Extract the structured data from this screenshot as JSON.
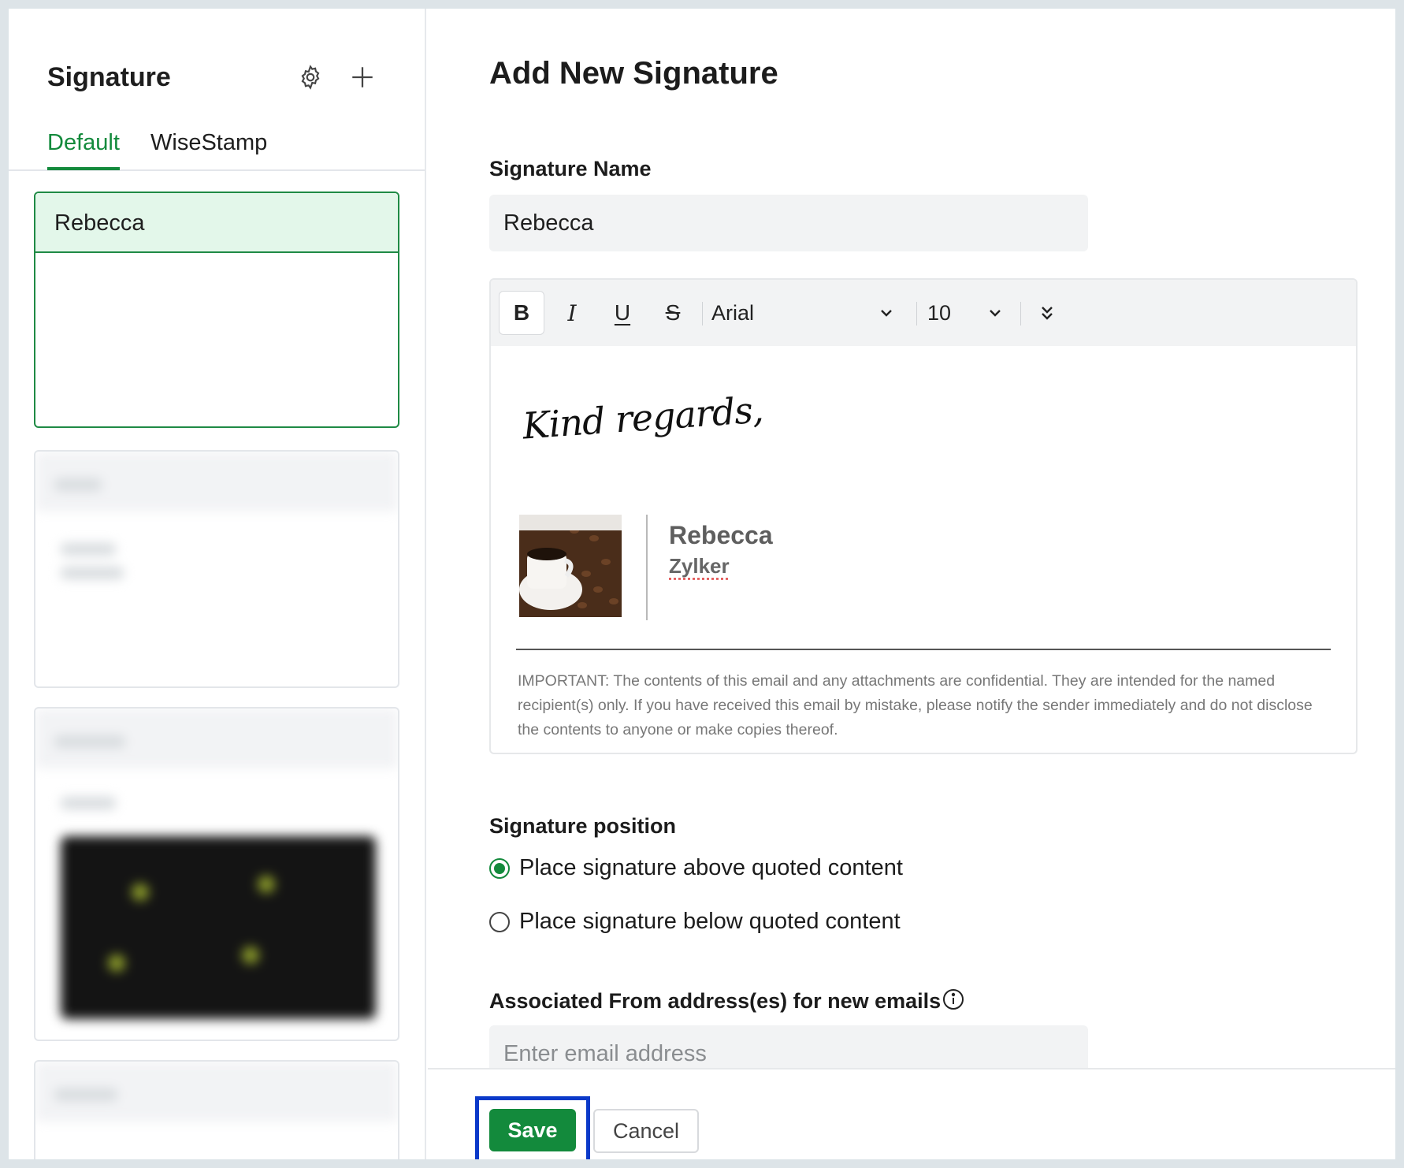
{
  "sidebar": {
    "title": "Signature",
    "tabs": [
      {
        "label": "Default"
      },
      {
        "label": "WiseStamp"
      }
    ],
    "active_card": {
      "name": "Rebecca"
    }
  },
  "main": {
    "title": "Add New Signature",
    "signature_name_label": "Signature Name",
    "signature_name_value": "Rebecca",
    "toolbar": {
      "bold": "B",
      "italic": "I",
      "underline": "U",
      "strike": "S",
      "font": "Arial",
      "size": "10"
    },
    "signature": {
      "closing": "Kind regards,",
      "name": "Rebecca",
      "company": "Zylker",
      "disclaimer": "IMPORTANT: The contents of this email and any attachments are confidential. They are intended for the named recipient(s) only. If you have received this email by mistake, please notify the sender immediately and do not disclose the contents to anyone or make copies thereof."
    },
    "position_label": "Signature position",
    "position_options": [
      {
        "label": "Place signature above quoted content",
        "selected": true
      },
      {
        "label": "Place signature below quoted content",
        "selected": false
      }
    ],
    "from_label": "Associated From address(es) for new emails",
    "email_placeholder": "Enter email address"
  },
  "footer": {
    "save_label": "Save",
    "cancel_label": "Cancel"
  },
  "colors": {
    "accent": "#138a3c",
    "highlight": "#0a39c9"
  }
}
